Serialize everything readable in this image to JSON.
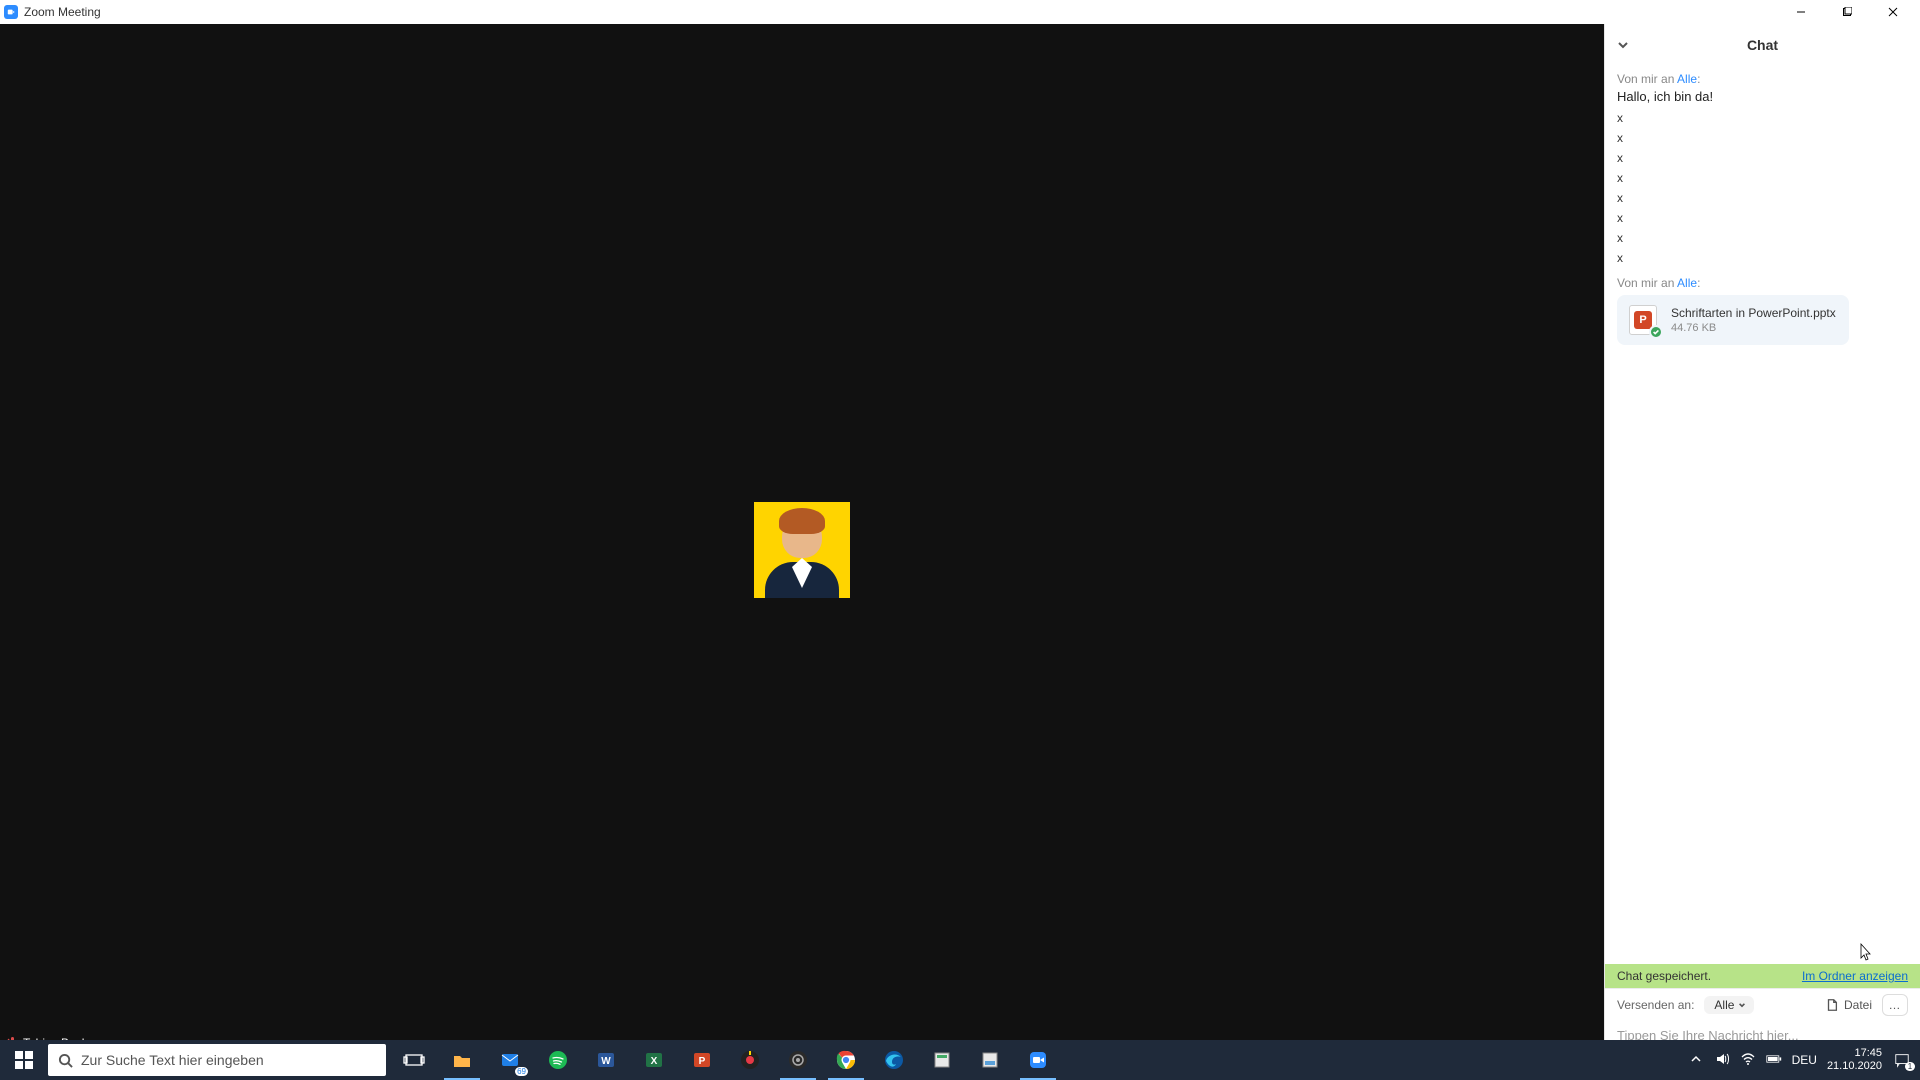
{
  "window": {
    "title": "Zoom Meeting"
  },
  "video": {
    "participant_name": "Tobias Becker"
  },
  "chat": {
    "header": "Chat",
    "messages": {
      "group1": {
        "from_prefix": "Von mir an ",
        "from_target": "Alle",
        "from_suffix": ":",
        "text": "Hallo, ich bin da!",
        "extras": [
          "x",
          "x",
          "x",
          "x",
          "x",
          "x",
          "x",
          "x"
        ]
      },
      "group2": {
        "from_prefix": "Von mir an ",
        "from_target": "Alle",
        "from_suffix": ":",
        "file": {
          "name": "Schriftarten in PowerPoint.pptx",
          "size": "44.76 KB",
          "badge": "P"
        }
      }
    },
    "saved_banner": {
      "text": "Chat gespeichert.",
      "link": "Im Ordner anzeigen"
    },
    "send_to_label": "Versenden an:",
    "send_to_value": "Alle",
    "file_button": "Datei",
    "more_button": "…",
    "compose_placeholder": "Tippen Sie Ihre Nachricht hier..."
  },
  "taskbar": {
    "search_placeholder": "Zur Suche Text hier eingeben",
    "mail_badge": "69",
    "lang": "DEU",
    "time": "17:45",
    "date": "21.10.2020",
    "notif_count": "1"
  }
}
